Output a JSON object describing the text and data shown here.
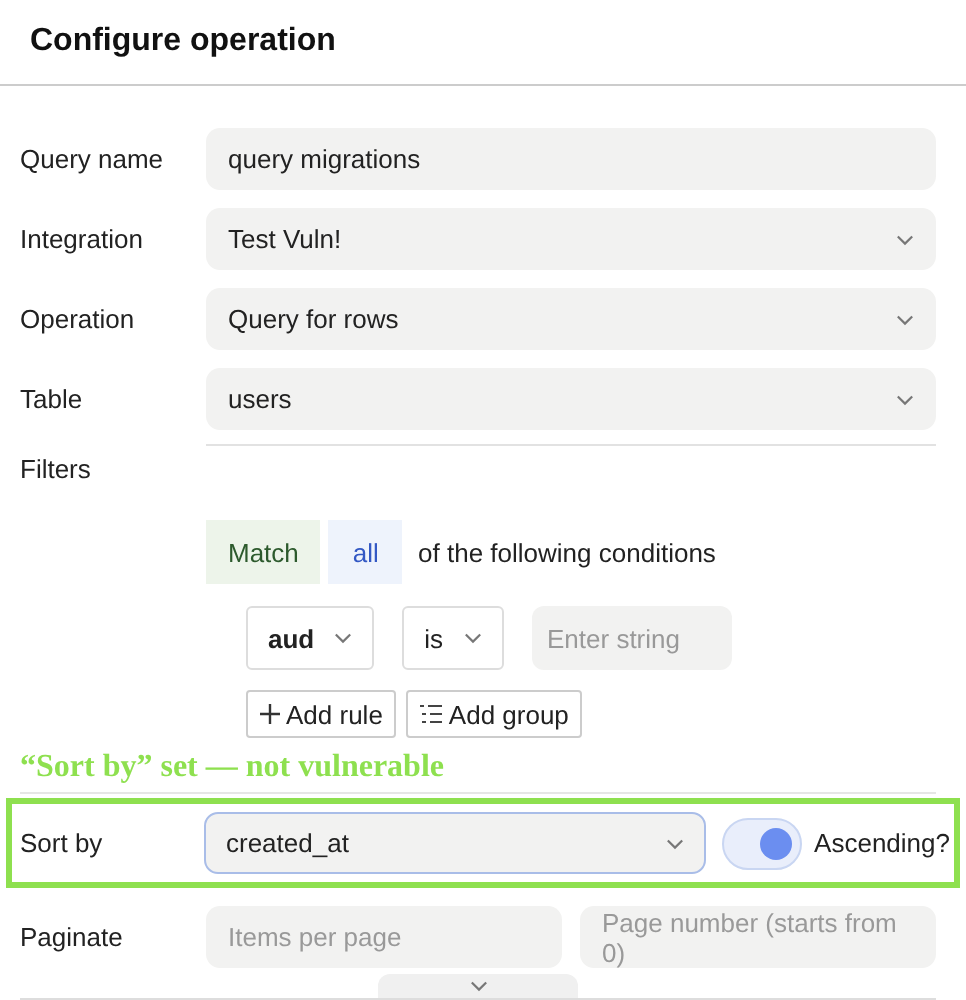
{
  "header": {
    "title": "Configure operation"
  },
  "fields": [
    {
      "label": "Query name",
      "kind": "text",
      "value": "query migrations"
    },
    {
      "label": "Integration",
      "kind": "select",
      "value": "Test Vuln!"
    },
    {
      "label": "Operation",
      "kind": "select",
      "value": "Query for rows"
    },
    {
      "label": "Table",
      "kind": "select",
      "value": "users"
    }
  ],
  "filters": {
    "label": "Filters",
    "match": "Match",
    "mode": "all",
    "suffix": "of the following conditions",
    "rule": {
      "field": "aud",
      "operator": "is",
      "placeholder": "Enter string"
    },
    "buttons": [
      {
        "label": "Add rule",
        "kind": "add"
      },
      {
        "label": "Add group",
        "kind": "group"
      }
    ]
  },
  "annotation": {
    "text": "“Sort by” set — not vulnerable"
  },
  "sort": {
    "label": "Sort by",
    "value": "created_at",
    "ascending": true,
    "toggle_label": "Ascending?"
  },
  "paginate": {
    "label": "Paginate",
    "placeholders": [
      "Items per page",
      "Page number (starts from 0)"
    ]
  }
}
